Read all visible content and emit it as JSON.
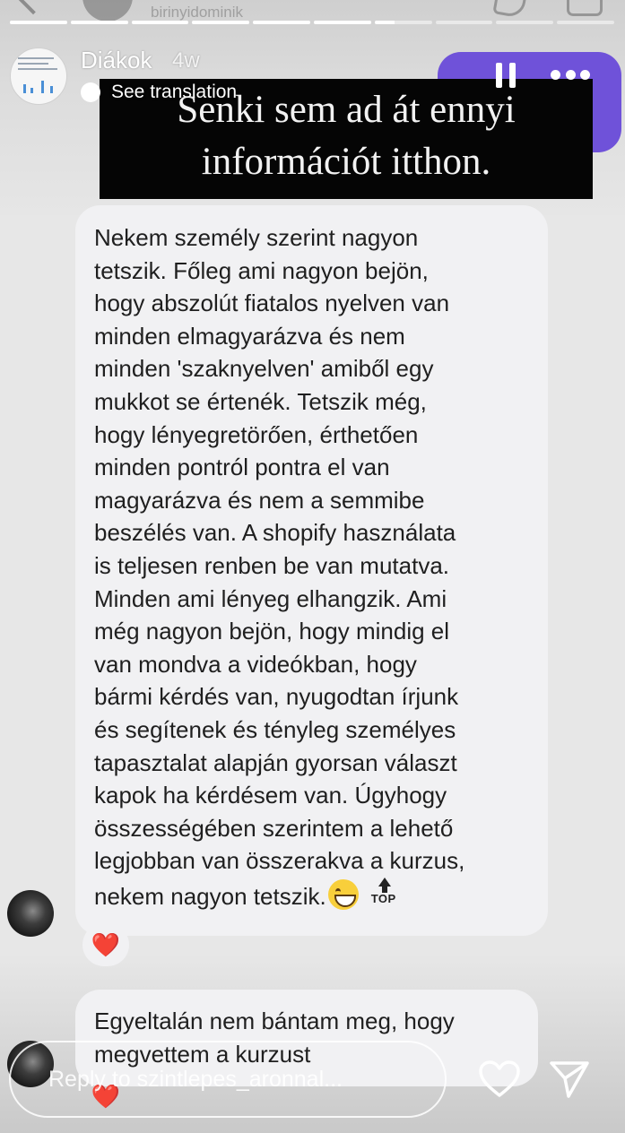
{
  "underlying_chat": {
    "username": "birinyidominik"
  },
  "story": {
    "progress": [
      1,
      1,
      1,
      1,
      1,
      1,
      0.35,
      0,
      0,
      0
    ],
    "author": "Diákok",
    "time": "4w",
    "translate_label": "See translation"
  },
  "caption": {
    "line1": "Senki sem ad át ennyi",
    "line2": "információt itthon."
  },
  "messages": [
    {
      "lines": [
        "Nekem személy szerint nagyon",
        "tetszik. Főleg ami nagyon bejön,",
        "hogy abszolút fiatalos nyelven van",
        "minden elmagyarázva és nem",
        "minden 'szaknyelven' amiből egy",
        "mukkot se értenék. Tetszik még,",
        "hogy lényegretörően, érthetően",
        "minden pontról pontra el van",
        "magyarázva és nem a semmibe",
        "beszélés van. A shopify használata",
        "is teljesen renben be van mutatva.",
        "Minden ami lényeg elhangzik. Ami",
        "még nagyon bejön, hogy mindig el",
        "van mondva a videókban, hogy",
        "bármi kérdés van, nyugodtan írjunk",
        "és segítenek és tényleg személyes",
        "tapasztalat alapján gyorsan választ",
        "kapok ha kérdésem van. Úgyhogy",
        "összességében szerintem a lehető",
        "legjobban van összerakva a kurzus,"
      ],
      "last_line": "nekem nagyon tetszik.",
      "top_label": "TOP",
      "reaction": "❤️"
    },
    {
      "lines": [
        "Egyeltalán nem bántam meg, hogy",
        "megvettem a kurzust"
      ],
      "reaction": "❤️"
    }
  ],
  "reply": {
    "placeholder": "Reply to szintlepes_aronnal..."
  },
  "icons": {
    "heart": "heart-outline-icon",
    "send": "paper-plane-icon",
    "pause": "pause-icon",
    "more": "more-dots-icon"
  },
  "colors": {
    "accent_bubble": "#6f52d9",
    "caption_bg": "#050505",
    "reaction": "#d71f2b"
  }
}
